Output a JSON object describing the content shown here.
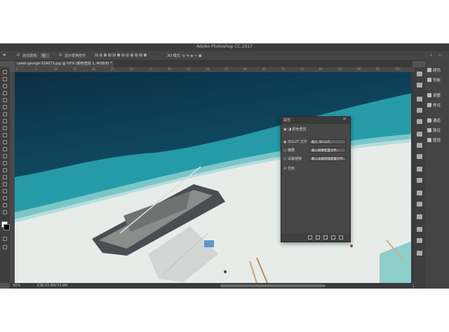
{
  "window": {
    "title": "Adobe Photoshop CC 2017"
  },
  "options_bar": {
    "auto_select_label": "自动选择:",
    "auto_select_value": "组",
    "show_transform_label": "显示变换控件"
  },
  "document_tab": {
    "label": "caleb-george-316073.jpg @ 50% (颜色查找 1, RGB/8) *"
  },
  "ruler_ticks": [
    "0",
    "5",
    "10",
    "15",
    "20",
    "25",
    "30",
    "35",
    "40",
    "45",
    "50",
    "55",
    "60",
    "65",
    "70",
    "75",
    "80",
    "85",
    "90",
    "95",
    "100"
  ],
  "status_bar": {
    "zoom": "50%",
    "doc_size": "文档:33.8M/33.8M"
  },
  "properties_panel": {
    "header": "属性",
    "title": "颜色查找",
    "rows": [
      {
        "label": "3DLUT 文件",
        "value": "载入 3D LUT..."
      },
      {
        "label": "摘要",
        "value": "载入摘要配置文件..."
      },
      {
        "label": "设备链接",
        "value": "载入设备链接配置文件..."
      }
    ],
    "dither_label": "仿色"
  },
  "right_panel": {
    "items": [
      "颜色",
      "色板",
      "调整",
      "样式",
      "通道",
      "路径",
      "图层"
    ]
  },
  "colors": {
    "ui_dark": "#535353",
    "deep_sea": "#0d3a52",
    "turquoise": "#2aa9b4",
    "sand": "#e8ece9"
  }
}
